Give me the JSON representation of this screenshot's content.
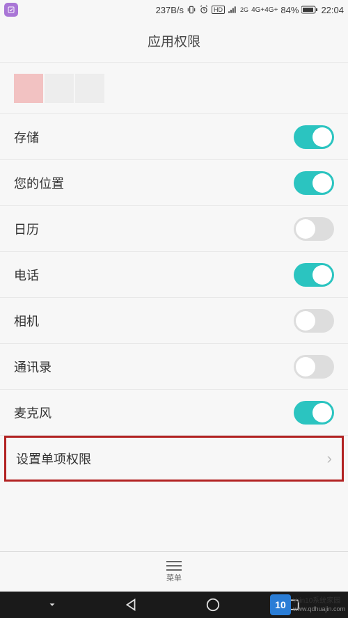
{
  "status": {
    "speed": "237B/s",
    "signal_label": "2G",
    "network_label": "4G+4G+",
    "battery_pct": "84%",
    "time": "22:04"
  },
  "header": {
    "title": "应用权限"
  },
  "permissions": [
    {
      "label": "存储",
      "enabled": true
    },
    {
      "label": "您的位置",
      "enabled": true
    },
    {
      "label": "日历",
      "enabled": false
    },
    {
      "label": "电话",
      "enabled": true
    },
    {
      "label": "相机",
      "enabled": false
    },
    {
      "label": "通讯录",
      "enabled": false
    },
    {
      "label": "麦克风",
      "enabled": true
    }
  ],
  "extra_row": {
    "label": "设置单项权限"
  },
  "bottom": {
    "menu_label": "菜单"
  },
  "watermark": {
    "logo_text": "10",
    "line1": "Win10系统家园",
    "line2": "www.qdhuajin.com"
  },
  "colors": {
    "accent": "#2bc4c0",
    "highlight_border": "#b22222"
  }
}
